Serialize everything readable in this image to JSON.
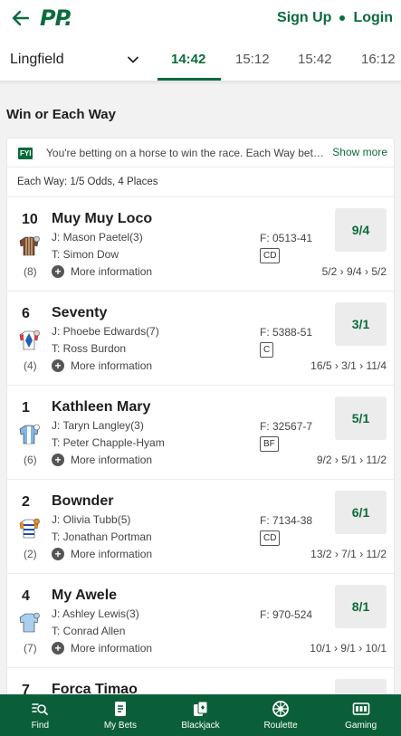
{
  "header": {
    "logo": "PP",
    "sign_up": "Sign Up",
    "login": "Login"
  },
  "race_nav": {
    "venue": "Lingfield",
    "times": [
      "14:42",
      "15:12",
      "15:42",
      "16:12"
    ],
    "active_time": "14:42"
  },
  "market": {
    "title": "Win or Each Way",
    "fyi_badge": "FYI",
    "fyi_text": "You're betting on a horse to win the race. Each Way bets ...",
    "show_more": "Show more",
    "each_way_terms": "Each Way: 1/5 Odds, 4 Places"
  },
  "runners": [
    {
      "number": "10",
      "draw": "(8)",
      "name": "Muy Muy Loco",
      "jockey": "J: Mason Paetel(3)",
      "trainer": "T: Simon Dow",
      "form": "F: 0513-41",
      "badge": "CD",
      "odds": "9/4",
      "movement": "5/2 › 9/4 › 5/2",
      "silk": "brown-stripes"
    },
    {
      "number": "6",
      "draw": "(4)",
      "name": "Seventy",
      "jockey": "J: Phoebe Edwards(7)",
      "trainer": "T: Ross Burdon",
      "form": "F: 5388-51",
      "badge": "C",
      "odds": "3/1",
      "movement": "16/5 › 3/1 › 11/4",
      "silk": "blue-white-diamond"
    },
    {
      "number": "1",
      "draw": "(6)",
      "name": "Kathleen Mary",
      "jockey": "J: Taryn Langley(3)",
      "trainer": "T: Peter Chapple-Hyam",
      "form": "F: 32567-7",
      "badge": "BF",
      "odds": "5/1",
      "movement": "9/2 › 5/1 › 11/2",
      "silk": "light-blue-white"
    },
    {
      "number": "2",
      "draw": "(2)",
      "name": "Bownder",
      "jockey": "J: Olivia Tubb(5)",
      "trainer": "T: Jonathan Portman",
      "form": "F: 7134-38",
      "badge": "CD",
      "odds": "6/1",
      "movement": "13/2 › 7/1 › 11/2",
      "silk": "orange-blue-hoops"
    },
    {
      "number": "4",
      "draw": "(7)",
      "name": "My Awele",
      "jockey": "J: Ashley Lewis(3)",
      "trainer": "T: Conrad Allen",
      "form": "F: 970-524",
      "badge": "",
      "odds": "8/1",
      "movement": "10/1 › 9/1 › 10/1",
      "silk": "pale-blue"
    },
    {
      "number": "7",
      "draw": "",
      "name": "Forca Timao",
      "jockey": "",
      "trainer": "",
      "form": "",
      "badge": "",
      "odds": "",
      "movement": "",
      "silk": ""
    }
  ],
  "bottom_nav": [
    {
      "label": "Find",
      "icon": "search-list-icon"
    },
    {
      "label": "My Bets",
      "icon": "bet-slip-icon"
    },
    {
      "label": "Blackjack",
      "icon": "cards-icon"
    },
    {
      "label": "Roulette",
      "icon": "roulette-wheel-icon"
    },
    {
      "label": "Gaming",
      "icon": "slot-machine-icon"
    }
  ],
  "colors": {
    "brand_green": "#0b6b3e",
    "nav_green": "#0b5f38",
    "odds_button_bg": "#ececec"
  }
}
